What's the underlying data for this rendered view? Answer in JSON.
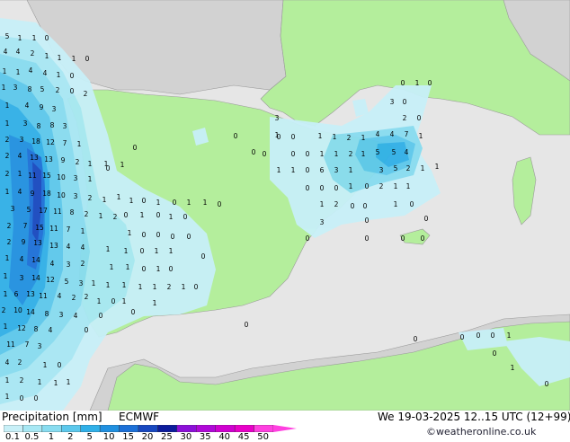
{
  "legend": {
    "title": "Precipitation [mm]",
    "model": "ECMWF",
    "datetime": "We 19-03-2025 12..15 UTC (12+99)",
    "credit": "©weatheronline.co.uk",
    "ticks": [
      "0.1",
      "0.5",
      "1",
      "2",
      "5",
      "10",
      "15",
      "20",
      "25",
      "30",
      "35",
      "40",
      "45",
      "50"
    ],
    "bins": [
      {
        "color": "#c8f0f8"
      },
      {
        "color": "#a8e8f4"
      },
      {
        "color": "#88dcf0"
      },
      {
        "color": "#5cc8ec"
      },
      {
        "color": "#30b0e8"
      },
      {
        "color": "#2090e0"
      },
      {
        "color": "#1c70d8"
      },
      {
        "color": "#1848c0"
      },
      {
        "color": "#0c1c9c"
      },
      {
        "color": "#8c10d8"
      },
      {
        "color": "#b008d8"
      },
      {
        "color": "#d000d0"
      },
      {
        "color": "#e800c8"
      },
      {
        "color": "#ff40e0"
      }
    ]
  },
  "colors": {
    "sea": "#e6e6e6",
    "land": "#b4ee9c",
    "outside": "#d2d2d2"
  },
  "points": [
    [
      "5",
      8,
      43
    ],
    [
      "1",
      22,
      45
    ],
    [
      "1",
      38,
      45
    ],
    [
      "0",
      52,
      45
    ],
    [
      "4",
      6,
      60
    ],
    [
      "4",
      20,
      60
    ],
    [
      "2",
      36,
      62
    ],
    [
      "1",
      52,
      65
    ],
    [
      "1",
      66,
      67
    ],
    [
      "1",
      82,
      68
    ],
    [
      "0",
      97,
      68
    ],
    [
      "1",
      5,
      82
    ],
    [
      "1",
      20,
      83
    ],
    [
      "4",
      34,
      81
    ],
    [
      "4",
      50,
      84
    ],
    [
      "1",
      65,
      86
    ],
    [
      "0",
      80,
      87
    ],
    [
      "1",
      4,
      100
    ],
    [
      "3",
      17,
      100
    ],
    [
      "8",
      33,
      102
    ],
    [
      "5",
      47,
      102
    ],
    [
      "2",
      64,
      103
    ],
    [
      "0",
      80,
      104
    ],
    [
      "2",
      95,
      107
    ],
    [
      "1",
      8,
      120
    ],
    [
      "4",
      30,
      120
    ],
    [
      "9",
      46,
      122
    ],
    [
      "3",
      60,
      124
    ],
    [
      "1",
      8,
      140
    ],
    [
      "3",
      28,
      140
    ],
    [
      "8",
      43,
      143
    ],
    [
      "8",
      58,
      142
    ],
    [
      "3",
      72,
      143
    ],
    [
      "2",
      8,
      158
    ],
    [
      "3",
      24,
      158
    ],
    [
      "18",
      40,
      160
    ],
    [
      "12",
      56,
      161
    ],
    [
      "7",
      72,
      162
    ],
    [
      "1",
      88,
      163
    ],
    [
      "2",
      8,
      176
    ],
    [
      "4",
      22,
      176
    ],
    [
      "13",
      38,
      178
    ],
    [
      "13",
      54,
      180
    ],
    [
      "9",
      70,
      181
    ],
    [
      "2",
      86,
      183
    ],
    [
      "1",
      100,
      185
    ],
    [
      "1",
      118,
      185
    ],
    [
      "2",
      8,
      196
    ],
    [
      "1",
      22,
      196
    ],
    [
      "11",
      36,
      198
    ],
    [
      "15",
      52,
      198
    ],
    [
      "10",
      68,
      200
    ],
    [
      "3",
      84,
      201
    ],
    [
      "1",
      100,
      202
    ],
    [
      "1",
      8,
      216
    ],
    [
      "4",
      22,
      216
    ],
    [
      "9",
      36,
      218
    ],
    [
      "18",
      52,
      218
    ],
    [
      "10",
      68,
      220
    ],
    [
      "3",
      84,
      221
    ],
    [
      "2",
      100,
      223
    ],
    [
      "1",
      116,
      225
    ],
    [
      "3",
      14,
      235
    ],
    [
      "5",
      32,
      236
    ],
    [
      "17",
      48,
      237
    ],
    [
      "11",
      64,
      238
    ],
    [
      "8",
      80,
      239
    ],
    [
      "2",
      96,
      241
    ],
    [
      "1",
      112,
      243
    ],
    [
      "2",
      128,
      244
    ],
    [
      "2",
      10,
      254
    ],
    [
      "7",
      28,
      254
    ],
    [
      "15",
      44,
      256
    ],
    [
      "11",
      60,
      257
    ],
    [
      "7",
      76,
      258
    ],
    [
      "1",
      92,
      260
    ],
    [
      "2",
      10,
      272
    ],
    [
      "9",
      26,
      272
    ],
    [
      "13",
      42,
      273
    ],
    [
      "13",
      60,
      276
    ],
    [
      "4",
      76,
      277
    ],
    [
      "4",
      92,
      278
    ],
    [
      "1",
      8,
      290
    ],
    [
      "4",
      24,
      291
    ],
    [
      "14",
      40,
      292
    ],
    [
      "4",
      58,
      296
    ],
    [
      "3",
      76,
      297
    ],
    [
      "2",
      92,
      296
    ],
    [
      "1",
      6,
      310
    ],
    [
      "3",
      24,
      312
    ],
    [
      "14",
      40,
      312
    ],
    [
      "12",
      56,
      314
    ],
    [
      "5",
      74,
      316
    ],
    [
      "3",
      90,
      318
    ],
    [
      "1",
      104,
      318
    ],
    [
      "1",
      6,
      330
    ],
    [
      "6",
      18,
      330
    ],
    [
      "13",
      34,
      330
    ],
    [
      "11",
      48,
      332
    ],
    [
      "4",
      66,
      332
    ],
    [
      "2",
      82,
      334
    ],
    [
      "2",
      96,
      333
    ],
    [
      "2",
      4,
      348
    ],
    [
      "10",
      20,
      348
    ],
    [
      "14",
      34,
      350
    ],
    [
      "8",
      52,
      352
    ],
    [
      "3",
      68,
      353
    ],
    [
      "4",
      84,
      354
    ],
    [
      "1",
      6,
      366
    ],
    [
      "12",
      24,
      368
    ],
    [
      "8",
      40,
      369
    ],
    [
      "4",
      56,
      370
    ],
    [
      "11",
      12,
      386
    ],
    [
      "7",
      30,
      386
    ],
    [
      "3",
      44,
      388
    ],
    [
      "4",
      8,
      406
    ],
    [
      "2",
      22,
      406
    ],
    [
      "1",
      50,
      409
    ],
    [
      "0",
      66,
      409
    ],
    [
      "1",
      8,
      426
    ],
    [
      "2",
      24,
      426
    ],
    [
      "1",
      44,
      428
    ],
    [
      "1",
      62,
      429
    ],
    [
      "1",
      76,
      428
    ],
    [
      "1",
      8,
      444
    ],
    [
      "0",
      24,
      446
    ],
    [
      "0",
      40,
      446
    ],
    [
      "0",
      150,
      167
    ],
    [
      "0",
      120,
      190
    ],
    [
      "1",
      136,
      186
    ],
    [
      "1",
      132,
      222
    ],
    [
      "1",
      146,
      226
    ],
    [
      "0",
      160,
      226
    ],
    [
      "1",
      176,
      228
    ],
    [
      "0",
      194,
      228
    ],
    [
      "1",
      210,
      228
    ],
    [
      "1",
      228,
      228
    ],
    [
      "0",
      244,
      230
    ],
    [
      "0",
      140,
      242
    ],
    [
      "1",
      158,
      242
    ],
    [
      "0",
      176,
      242
    ],
    [
      "1",
      190,
      244
    ],
    [
      "0",
      206,
      244
    ],
    [
      "1",
      144,
      262
    ],
    [
      "0",
      160,
      264
    ],
    [
      "0",
      176,
      264
    ],
    [
      "0",
      192,
      266
    ],
    [
      "0",
      210,
      266
    ],
    [
      "1",
      120,
      280
    ],
    [
      "1",
      140,
      282
    ],
    [
      "0",
      158,
      282
    ],
    [
      "1",
      174,
      282
    ],
    [
      "1",
      190,
      282
    ],
    [
      "0",
      226,
      288
    ],
    [
      "1",
      124,
      300
    ],
    [
      "1",
      142,
      300
    ],
    [
      "0",
      160,
      302
    ],
    [
      "1",
      176,
      302
    ],
    [
      "0",
      190,
      302
    ],
    [
      "1",
      120,
      320
    ],
    [
      "1",
      138,
      320
    ],
    [
      "1",
      156,
      322
    ],
    [
      "1",
      172,
      322
    ],
    [
      "2",
      188,
      322
    ],
    [
      "1",
      204,
      322
    ],
    [
      "0",
      218,
      322
    ],
    [
      "1",
      110,
      338
    ],
    [
      "0",
      126,
      338
    ],
    [
      "1",
      138,
      338
    ],
    [
      "1",
      172,
      340
    ],
    [
      "0",
      112,
      354
    ],
    [
      "0",
      148,
      350
    ],
    [
      "0",
      96,
      370
    ],
    [
      "0",
      274,
      364
    ],
    [
      "0",
      262,
      154
    ],
    [
      "0",
      282,
      172
    ],
    [
      "0",
      294,
      174
    ],
    [
      "0",
      310,
      155
    ],
    [
      "0",
      326,
      155
    ],
    [
      "1",
      356,
      154
    ],
    [
      "1",
      372,
      155
    ],
    [
      "2",
      388,
      156
    ],
    [
      "1",
      404,
      156
    ],
    [
      "4",
      420,
      152
    ],
    [
      "4",
      436,
      152
    ],
    [
      "7",
      452,
      152
    ],
    [
      "1",
      468,
      154
    ],
    [
      "0",
      326,
      174
    ],
    [
      "0",
      342,
      174
    ],
    [
      "1",
      358,
      174
    ],
    [
      "1",
      374,
      174
    ],
    [
      "2",
      390,
      174
    ],
    [
      "1",
      404,
      174
    ],
    [
      "5",
      420,
      172
    ],
    [
      "5",
      438,
      172
    ],
    [
      "4",
      452,
      172
    ],
    [
      "1",
      310,
      192
    ],
    [
      "1",
      326,
      192
    ],
    [
      "0",
      342,
      192
    ],
    [
      "6",
      358,
      192
    ],
    [
      "3",
      374,
      192
    ],
    [
      "1",
      390,
      192
    ],
    [
      "3",
      424,
      192
    ],
    [
      "5",
      440,
      190
    ],
    [
      "2",
      454,
      190
    ],
    [
      "1",
      470,
      190
    ],
    [
      "1",
      486,
      188
    ],
    [
      "0",
      342,
      212
    ],
    [
      "0",
      358,
      212
    ],
    [
      "0",
      374,
      212
    ],
    [
      "1",
      390,
      210
    ],
    [
      "0",
      408,
      210
    ],
    [
      "2",
      424,
      210
    ],
    [
      "1",
      440,
      210
    ],
    [
      "1",
      454,
      210
    ],
    [
      "1",
      358,
      230
    ],
    [
      "2",
      374,
      230
    ],
    [
      "0",
      392,
      232
    ],
    [
      "0",
      406,
      232
    ],
    [
      "1",
      440,
      230
    ],
    [
      "0",
      458,
      230
    ],
    [
      "3",
      358,
      250
    ],
    [
      "0",
      408,
      248
    ],
    [
      "0",
      474,
      246
    ],
    [
      "0",
      470,
      268
    ],
    [
      "0",
      342,
      268
    ],
    [
      "0",
      408,
      268
    ],
    [
      "0",
      448,
      268
    ],
    [
      "3",
      308,
      134
    ],
    [
      "1",
      308,
      153
    ],
    [
      "0",
      448,
      95
    ],
    [
      "1",
      464,
      95
    ],
    [
      "0",
      478,
      95
    ],
    [
      "3",
      436,
      116
    ],
    [
      "0",
      450,
      116
    ],
    [
      "2",
      450,
      134
    ],
    [
      "0",
      466,
      134
    ],
    [
      "0",
      462,
      380
    ],
    [
      "0",
      514,
      378
    ],
    [
      "0",
      532,
      376
    ],
    [
      "0",
      548,
      376
    ],
    [
      "1",
      566,
      376
    ],
    [
      "0",
      550,
      396
    ],
    [
      "1",
      570,
      412
    ],
    [
      "0",
      608,
      430
    ]
  ]
}
